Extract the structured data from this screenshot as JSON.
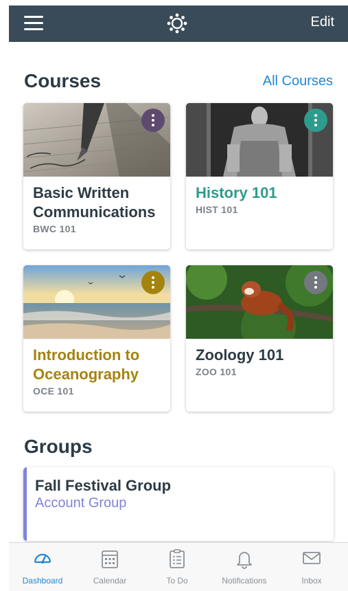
{
  "navbar": {
    "edit_label": "Edit"
  },
  "courses": {
    "title": "Courses",
    "all_courses_label": "All Courses",
    "items": [
      {
        "name": "Basic Written Communications",
        "code": "BWC 101",
        "color": "#5d4a6e",
        "name_color": "#2d3b45",
        "image": "pen-writing"
      },
      {
        "name": "History 101",
        "code": "HIST 101",
        "color": "#2e9c8c",
        "name_color": "#2e9c8c",
        "image": "lincoln-statue"
      },
      {
        "name": "Introduction to Oceanography",
        "code": "OCE 101",
        "color": "#a5830f",
        "name_color": "#a5830f",
        "image": "ocean-sunset"
      },
      {
        "name": "Zoology 101",
        "code": "ZOO 101",
        "color": "#737880",
        "name_color": "#2d3b45",
        "image": "red-panda"
      }
    ]
  },
  "groups": {
    "title": "Groups",
    "items": [
      {
        "name": "Fall Festival Group",
        "type": "Account Group",
        "color": "#8083d9"
      }
    ]
  },
  "tabbar": {
    "items": [
      {
        "label": "Dashboard",
        "icon": "dashboard-icon",
        "active": true
      },
      {
        "label": "Calendar",
        "icon": "calendar-icon",
        "active": false
      },
      {
        "label": "To Do",
        "icon": "todo-icon",
        "active": false
      },
      {
        "label": "Notifications",
        "icon": "bell-icon",
        "active": false
      },
      {
        "label": "Inbox",
        "icon": "inbox-icon",
        "active": false
      }
    ]
  }
}
